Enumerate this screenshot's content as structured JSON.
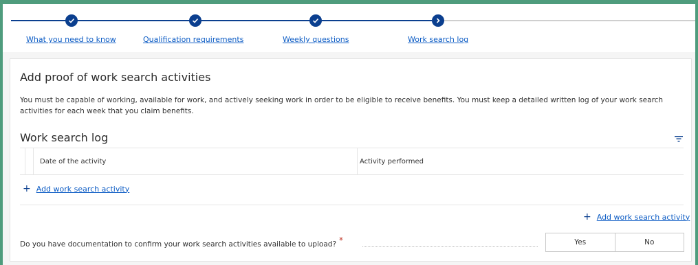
{
  "steps": [
    {
      "label": "What you need to know",
      "status": "complete",
      "icon": "check-icon"
    },
    {
      "label": "Qualification requirements",
      "status": "complete",
      "icon": "check-icon"
    },
    {
      "label": "Weekly questions",
      "status": "complete",
      "icon": "check-icon"
    },
    {
      "label": "Work search log",
      "status": "current",
      "icon": "chevron-right-icon"
    }
  ],
  "card": {
    "title": "Add proof of work search activities",
    "description": "You must be capable of working, available for work, and actively seeking work in order to be eligible to receive benefits. You must keep a detailed written log of your work search activities for each week that you claim benefits."
  },
  "log": {
    "title": "Work search log",
    "columns": [
      "Date of the activity",
      "Activity performed"
    ],
    "add_label": "Add work search activity",
    "add_label_bottom": "Add work search activity"
  },
  "question": {
    "text": "Do you have documentation to confirm your work search activities available to upload?",
    "required_mark": "*",
    "yes": "Yes",
    "no": "No"
  },
  "colors": {
    "accent": "#0b3f8f",
    "link": "#0b5bc4",
    "page_border": "#4f9c7d",
    "required": "#c0392b"
  }
}
